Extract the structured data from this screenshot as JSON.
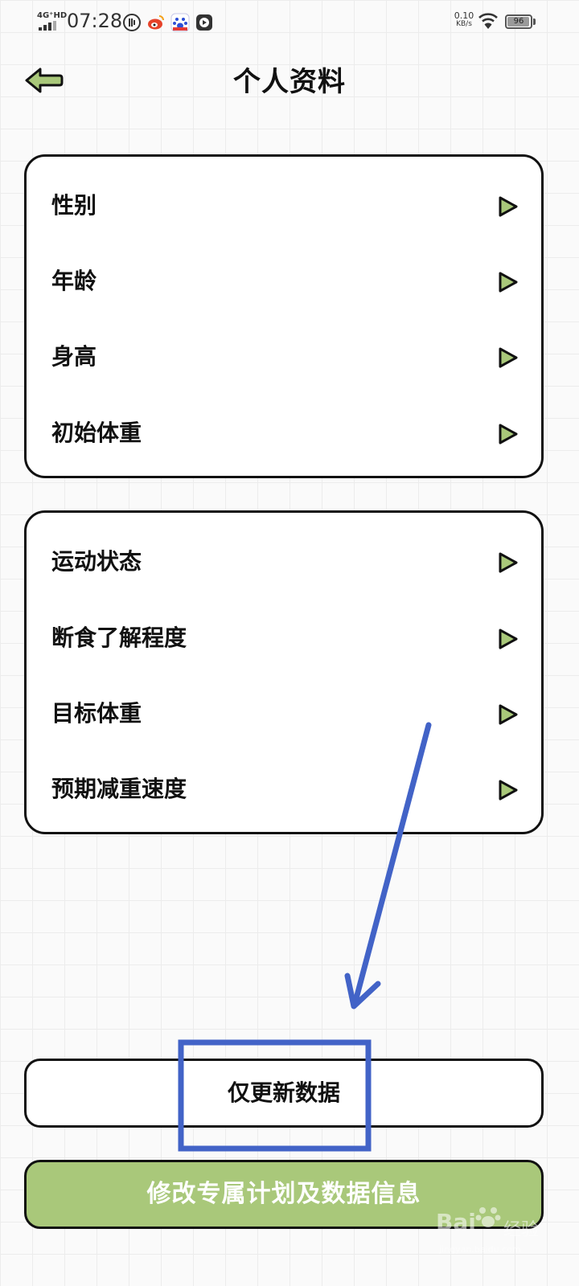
{
  "status_bar": {
    "network": "4G⁺HD",
    "time": "07:28",
    "net_speed_value": "0.10",
    "net_speed_unit": "KB/s",
    "battery": "96",
    "icons": [
      "unicom-icon",
      "weibo-icon",
      "baidu-app-icon",
      "video-play-icon",
      "wifi-icon"
    ]
  },
  "header": {
    "title": "个人资料",
    "back_icon": "back-arrow-icon"
  },
  "profile_card": {
    "items": [
      {
        "label": "性别"
      },
      {
        "label": "年龄"
      },
      {
        "label": "身高"
      },
      {
        "label": "初始体重"
      }
    ]
  },
  "plan_card": {
    "items": [
      {
        "label": "运动状态"
      },
      {
        "label": "断食了解程度"
      },
      {
        "label": "目标体重"
      },
      {
        "label": "预期减重速度"
      }
    ]
  },
  "actions": {
    "update_data_label": "仅更新数据",
    "modify_plan_label": "修改专属计划及数据信息"
  },
  "watermark": {
    "logo": "Bai",
    "text": "经验",
    "url": "jingyan.baidu.com"
  },
  "colors": {
    "accent_green": "#a9c87a",
    "arrow_fill": "#a9c87a",
    "annotation_blue": "#4263c7",
    "border": "#111111"
  }
}
